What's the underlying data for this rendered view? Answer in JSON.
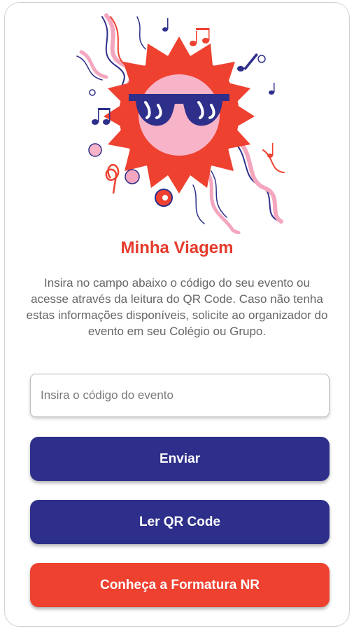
{
  "app": {
    "title": "Minha Viagem",
    "description": "Insira no campo abaixo o código do seu evento ou acesse através da leitura do QR Code. Caso não tenha estas informações disponíveis, solicite ao organizador do evento em seu Colégio ou Grupo."
  },
  "form": {
    "event_code": {
      "value": "",
      "placeholder": "Insira o código do evento"
    }
  },
  "buttons": {
    "send_label": "Enviar",
    "qr_label": "Ler QR Code",
    "nr_label": "Conheça a Formatura NR"
  },
  "icons": {
    "hero": "sun-with-sunglasses-illustration"
  },
  "colors": {
    "accent_red": "#ee4130",
    "title_red": "#e53b2c",
    "navy": "#2e2f8b",
    "text_gray": "#666666"
  }
}
